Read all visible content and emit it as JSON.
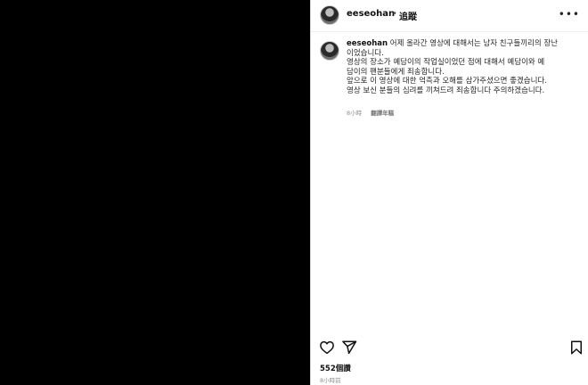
{
  "post": {
    "username": "eeseohan",
    "separator": "•",
    "follow_label": "追蹤",
    "more_label": "•••"
  },
  "caption": {
    "username": "eeseohan",
    "lines": [
      "어제 올라간 영상에 대해서는 남자 친구들끼리의 장난",
      "이었습니다.",
      "영상의 장소가 예담이의 작업실이었던 점에 대해서 예담이와 예",
      "담이의 팬분들에게 죄송합니다.",
      "앞으로 이 영상에 대한 억측과 오해를 삼가주셨으면 좋겠습니다.",
      "영상 보신 분들의 심려를 끼쳐드려 죄송합니다 주의하겠습니다."
    ],
    "time": "8小時",
    "translate_label": "翻譯年糕"
  },
  "actions": {
    "like_icon": "heart-icon",
    "share_icon": "share-icon",
    "save_icon": "bookmark-icon"
  },
  "stats": {
    "likes": "552個讚",
    "posted": "8小時前"
  },
  "colors": {
    "media_bg": "#000000",
    "text": "#262626",
    "muted": "#8e8e8e"
  }
}
